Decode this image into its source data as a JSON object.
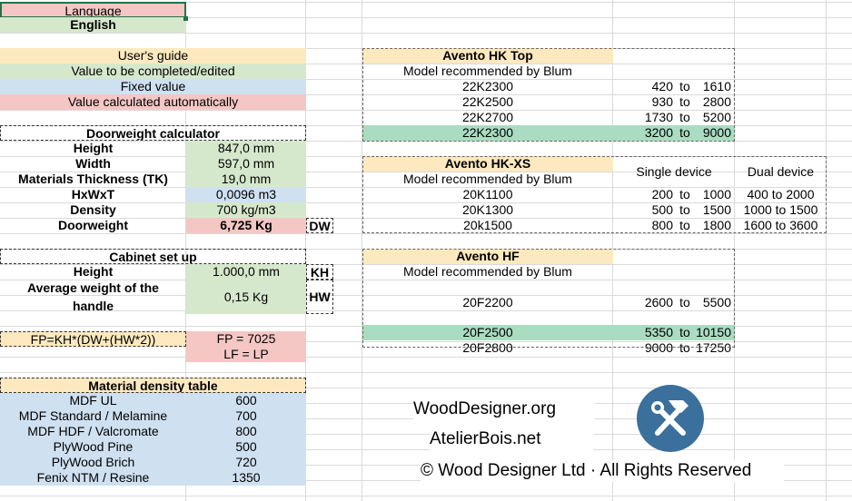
{
  "language": {
    "label": "Language",
    "value": "English"
  },
  "legend": {
    "guide": "User's guide",
    "completed": "Value to be completed/edited",
    "fixed": "Fixed value",
    "auto": "Value calculated automatically"
  },
  "doorweight": {
    "title": "Doorweight calculator",
    "height_label": "Height",
    "height_value": "847,0  mm",
    "width_label": "Width",
    "width_value": "597,0  mm",
    "thickness_label": "Materials Thickness (TK)",
    "thickness_value": "19,0  mm",
    "hxwxt_label": "HxWxT",
    "hxwxt_value": "0,0096 m3",
    "density_label": "Density",
    "density_value": "700 kg/m3",
    "doorweight_label": "Doorweight",
    "doorweight_value": "6,725 Kg",
    "doorweight_tag": "DW"
  },
  "cabinet": {
    "title": "Cabinet set up",
    "height_label": "Height",
    "height_value": "1.000,0 mm",
    "height_tag": "KH",
    "handle_label_1": "Average weight of the",
    "handle_label_2": "handle",
    "handle_value": "0,15 Kg",
    "handle_tag": "HW"
  },
  "formula": {
    "fp_formula": "FP=KH*(DW+(HW*2))",
    "fp_value": "FP = 7025",
    "lf": "LF = LP"
  },
  "density_table": {
    "title": "Material density table",
    "rows": [
      {
        "material": "MDF UL",
        "density": "600"
      },
      {
        "material": "MDF  Standard / Melamine",
        "density": "700"
      },
      {
        "material": "MDF HDF / Valcromate",
        "density": "800"
      },
      {
        "material": "PlyWood Pine",
        "density": "500"
      },
      {
        "material": "PlyWood Brich",
        "density": "720"
      },
      {
        "material": "Fenix NTM / Resine",
        "density": "1350"
      }
    ]
  },
  "hk_top": {
    "title": "Avento HK Top",
    "subtitle": "Model recommended by Blum",
    "rows": [
      {
        "model": "22K2300",
        "min": "420",
        "to": "to",
        "max": "1610"
      },
      {
        "model": "22K2500",
        "min": "930",
        "to": "to",
        "max": "2800"
      },
      {
        "model": "22K2700",
        "min": "1730",
        "to": "to",
        "max": "5200"
      },
      {
        "model": "22K2300",
        "min": "3200",
        "to": "to",
        "max": "9000"
      }
    ]
  },
  "hk_xs": {
    "title": "Avento HK-XS",
    "subtitle": "Model recommended by Blum",
    "single_header": "Single device",
    "dual_header": "Dual device",
    "rows": [
      {
        "model": "20K1100",
        "min": "200",
        "to": "to",
        "max": "1000",
        "dual": "400 to 2000"
      },
      {
        "model": "20K1300",
        "min": "500",
        "to": "to",
        "max": "1500",
        "dual": "1000 to 1500"
      },
      {
        "model": "20k1500",
        "min": "800",
        "to": "to",
        "max": "1800",
        "dual": "1600 to 3600"
      }
    ]
  },
  "hf": {
    "title": "Avento HF",
    "subtitle": "Model recommended by Blum",
    "rows": [
      {
        "model": "20F2200",
        "min": "2600",
        "to": "to",
        "max": "5500"
      },
      {
        "model": "20F2500",
        "min": "5350",
        "to": "to",
        "max": "10150"
      },
      {
        "model": "20F2800",
        "min": "9000",
        "to": "to",
        "max": "17250"
      }
    ]
  },
  "branding": {
    "site1": "WoodDesigner.org",
    "site2": "AtelierBois.net",
    "copyright": "© Wood Designer Ltd · All Rights Reserved"
  },
  "colors": {
    "guide": "#fde9bf",
    "completed": "#d6e8cc",
    "fixed": "#cfe0f1",
    "auto": "#f4c7c4",
    "highlight": "#a9dcc0",
    "logo": "#3b6f9c",
    "selection": "#217346"
  },
  "icons": {
    "logo": "hammer-wrench-icon"
  }
}
